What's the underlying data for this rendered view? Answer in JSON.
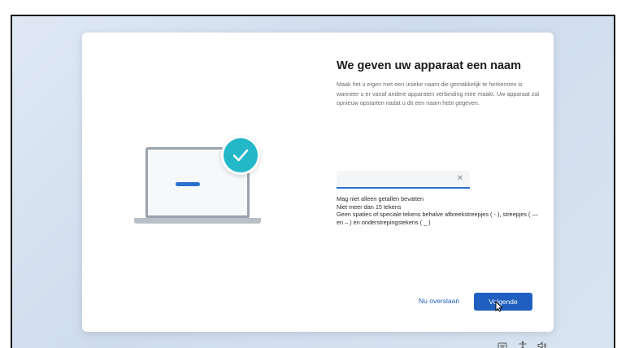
{
  "caption": {
    "text_black": "",
    "text_red": "",
    "red_color": "#e0261b"
  },
  "setup": {
    "title": "We geven uw apparaat een naam",
    "description": "Maak het u eigen met een unieke naam die gemakkelijk te herkennen is wanneer u er vanaf andere apparaten verbinding mee maakt. Uw apparaat zal opnieuw opstarten nadat u dit een naam hebt gegeven.",
    "name_input": {
      "value": "",
      "placeholder": ""
    },
    "rules": [
      "Mag niet alleen getallen bevatten",
      "Niet meer dan 15 tekens",
      "Geen spaties of speciale tekens behalve afbreekstreepjes ( - ), streepjes ( — en – ) en onderstrepingstekens ( _ )"
    ],
    "skip_label": "Nu overslaan",
    "next_label": "Volgende"
  },
  "icons": {
    "illustration": "laptop-icon",
    "check": "checkmark-icon",
    "clear": "close-icon",
    "tray": [
      "keyboard-icon",
      "accessibility-icon",
      "speaker-icon"
    ]
  },
  "colors": {
    "accent": "#1f5fbf",
    "check_teal": "#22b8c8",
    "background": "#d9e4f1"
  }
}
